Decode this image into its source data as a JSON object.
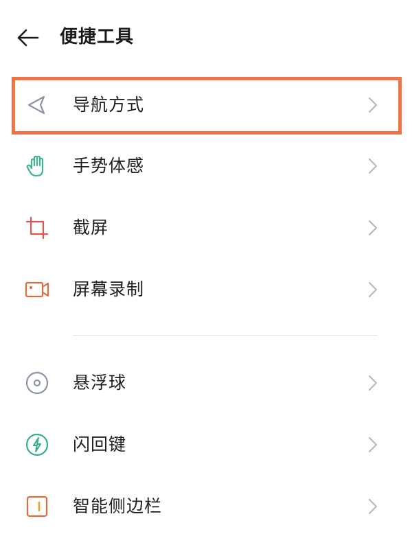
{
  "header": {
    "title": "便捷工具"
  },
  "items": [
    {
      "label": "导航方式",
      "icon": "navigation-arrow-icon",
      "color": "#8a93a3",
      "highlighted": true
    },
    {
      "label": "手势体感",
      "icon": "hand-gesture-icon",
      "color": "#3fb58a"
    },
    {
      "label": "截屏",
      "icon": "crop-icon",
      "color": "#d9574f"
    },
    {
      "label": "屏幕录制",
      "icon": "video-record-icon",
      "color": "#e06a3c"
    },
    {
      "label": "悬浮球",
      "icon": "floating-ball-icon",
      "color": "#8a93a3"
    },
    {
      "label": "闪回键",
      "icon": "flashback-icon",
      "color": "#2fb08b"
    },
    {
      "label": "智能侧边栏",
      "icon": "smart-sidebar-icon",
      "color": "#e06a3c"
    }
  ],
  "colors": {
    "highlight": "#f07346",
    "chevron": "#b9b9b9"
  }
}
